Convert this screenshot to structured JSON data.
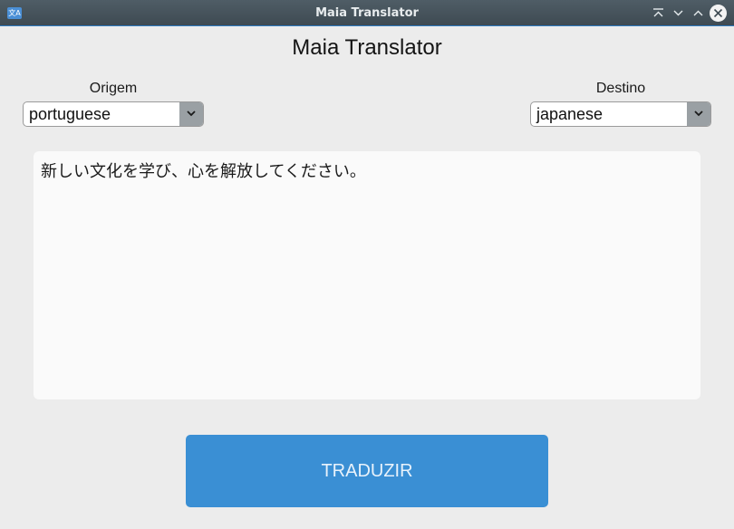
{
  "window": {
    "title": "Maia Translator",
    "icon_label": "文A",
    "controls": [
      "keep-above-icon",
      "minimize-icon",
      "maximize-icon",
      "close-icon"
    ]
  },
  "app": {
    "title": "Maia Translator",
    "source": {
      "label": "Origem",
      "selected": "portuguese"
    },
    "target": {
      "label": "Destino",
      "selected": "japanese"
    },
    "text": "新しい文化を学び、心を解放してください。",
    "translate_button": "TRADUZIR"
  },
  "colors": {
    "titlebar": "#45525a",
    "accent": "#3a8fd4",
    "background": "#ececec"
  }
}
